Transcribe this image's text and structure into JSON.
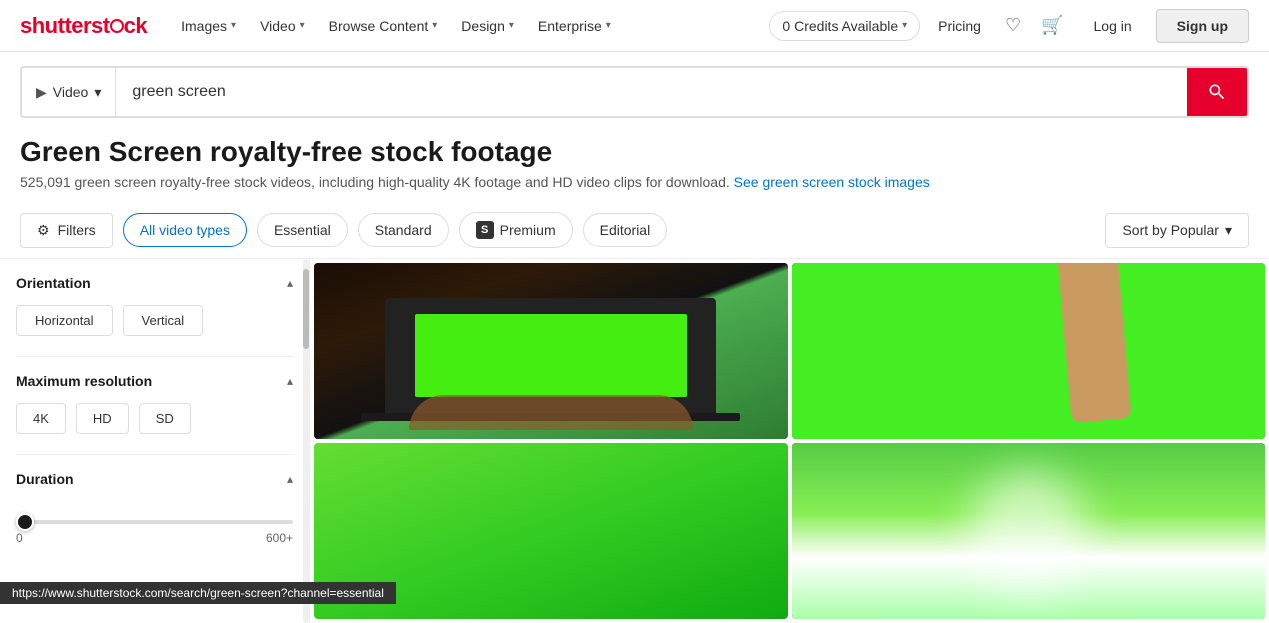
{
  "brand": {
    "name": "shutterstøck",
    "logo_text": "shutterstock"
  },
  "navbar": {
    "links": [
      {
        "label": "Images",
        "has_dropdown": true
      },
      {
        "label": "Video",
        "has_dropdown": true
      },
      {
        "label": "Browse Content",
        "has_dropdown": true
      },
      {
        "label": "Design",
        "has_dropdown": true
      },
      {
        "label": "Enterprise",
        "has_dropdown": true
      }
    ],
    "credits": "0 Credits Available",
    "pricing": "Pricing",
    "login": "Log in",
    "signup": "Sign up"
  },
  "search": {
    "type": "Video",
    "query": "green screen",
    "placeholder": "green screen"
  },
  "hero": {
    "title": "Green Screen royalty-free stock footage",
    "subtitle": "525,091 green screen royalty-free stock videos, including high-quality 4K footage and HD video clips for download.",
    "link_text": "See green screen stock images"
  },
  "filters": {
    "filters_label": "Filters",
    "video_types": [
      {
        "label": "All video types",
        "active": true
      },
      {
        "label": "Essential",
        "active": false
      },
      {
        "label": "Standard",
        "active": false
      },
      {
        "label": "Premium",
        "active": false,
        "has_badge": true
      },
      {
        "label": "Editorial",
        "active": false
      }
    ],
    "sort_label": "Sort by Popular"
  },
  "sidebar": {
    "sections": [
      {
        "id": "orientation",
        "title": "Orientation",
        "collapsed": false,
        "options": [
          {
            "label": "Horizontal"
          },
          {
            "label": "Vertical"
          }
        ]
      },
      {
        "id": "resolution",
        "title": "Maximum resolution",
        "collapsed": false,
        "options": [
          {
            "label": "4K"
          },
          {
            "label": "HD"
          },
          {
            "label": "SD"
          }
        ]
      },
      {
        "id": "duration",
        "title": "Duration",
        "collapsed": false,
        "slider_min": "0",
        "slider_max": "600+",
        "slider_value": 0
      }
    ]
  },
  "status_bar": {
    "url": "https://www.shutterstock.com/search/green-screen?channel=essential"
  },
  "icons": {
    "search": "🔍",
    "filter": "⚙",
    "chevron_down": "▾",
    "chevron_up": "▴",
    "heart": "♡",
    "cart": "🛒",
    "video_camera": "▶"
  }
}
